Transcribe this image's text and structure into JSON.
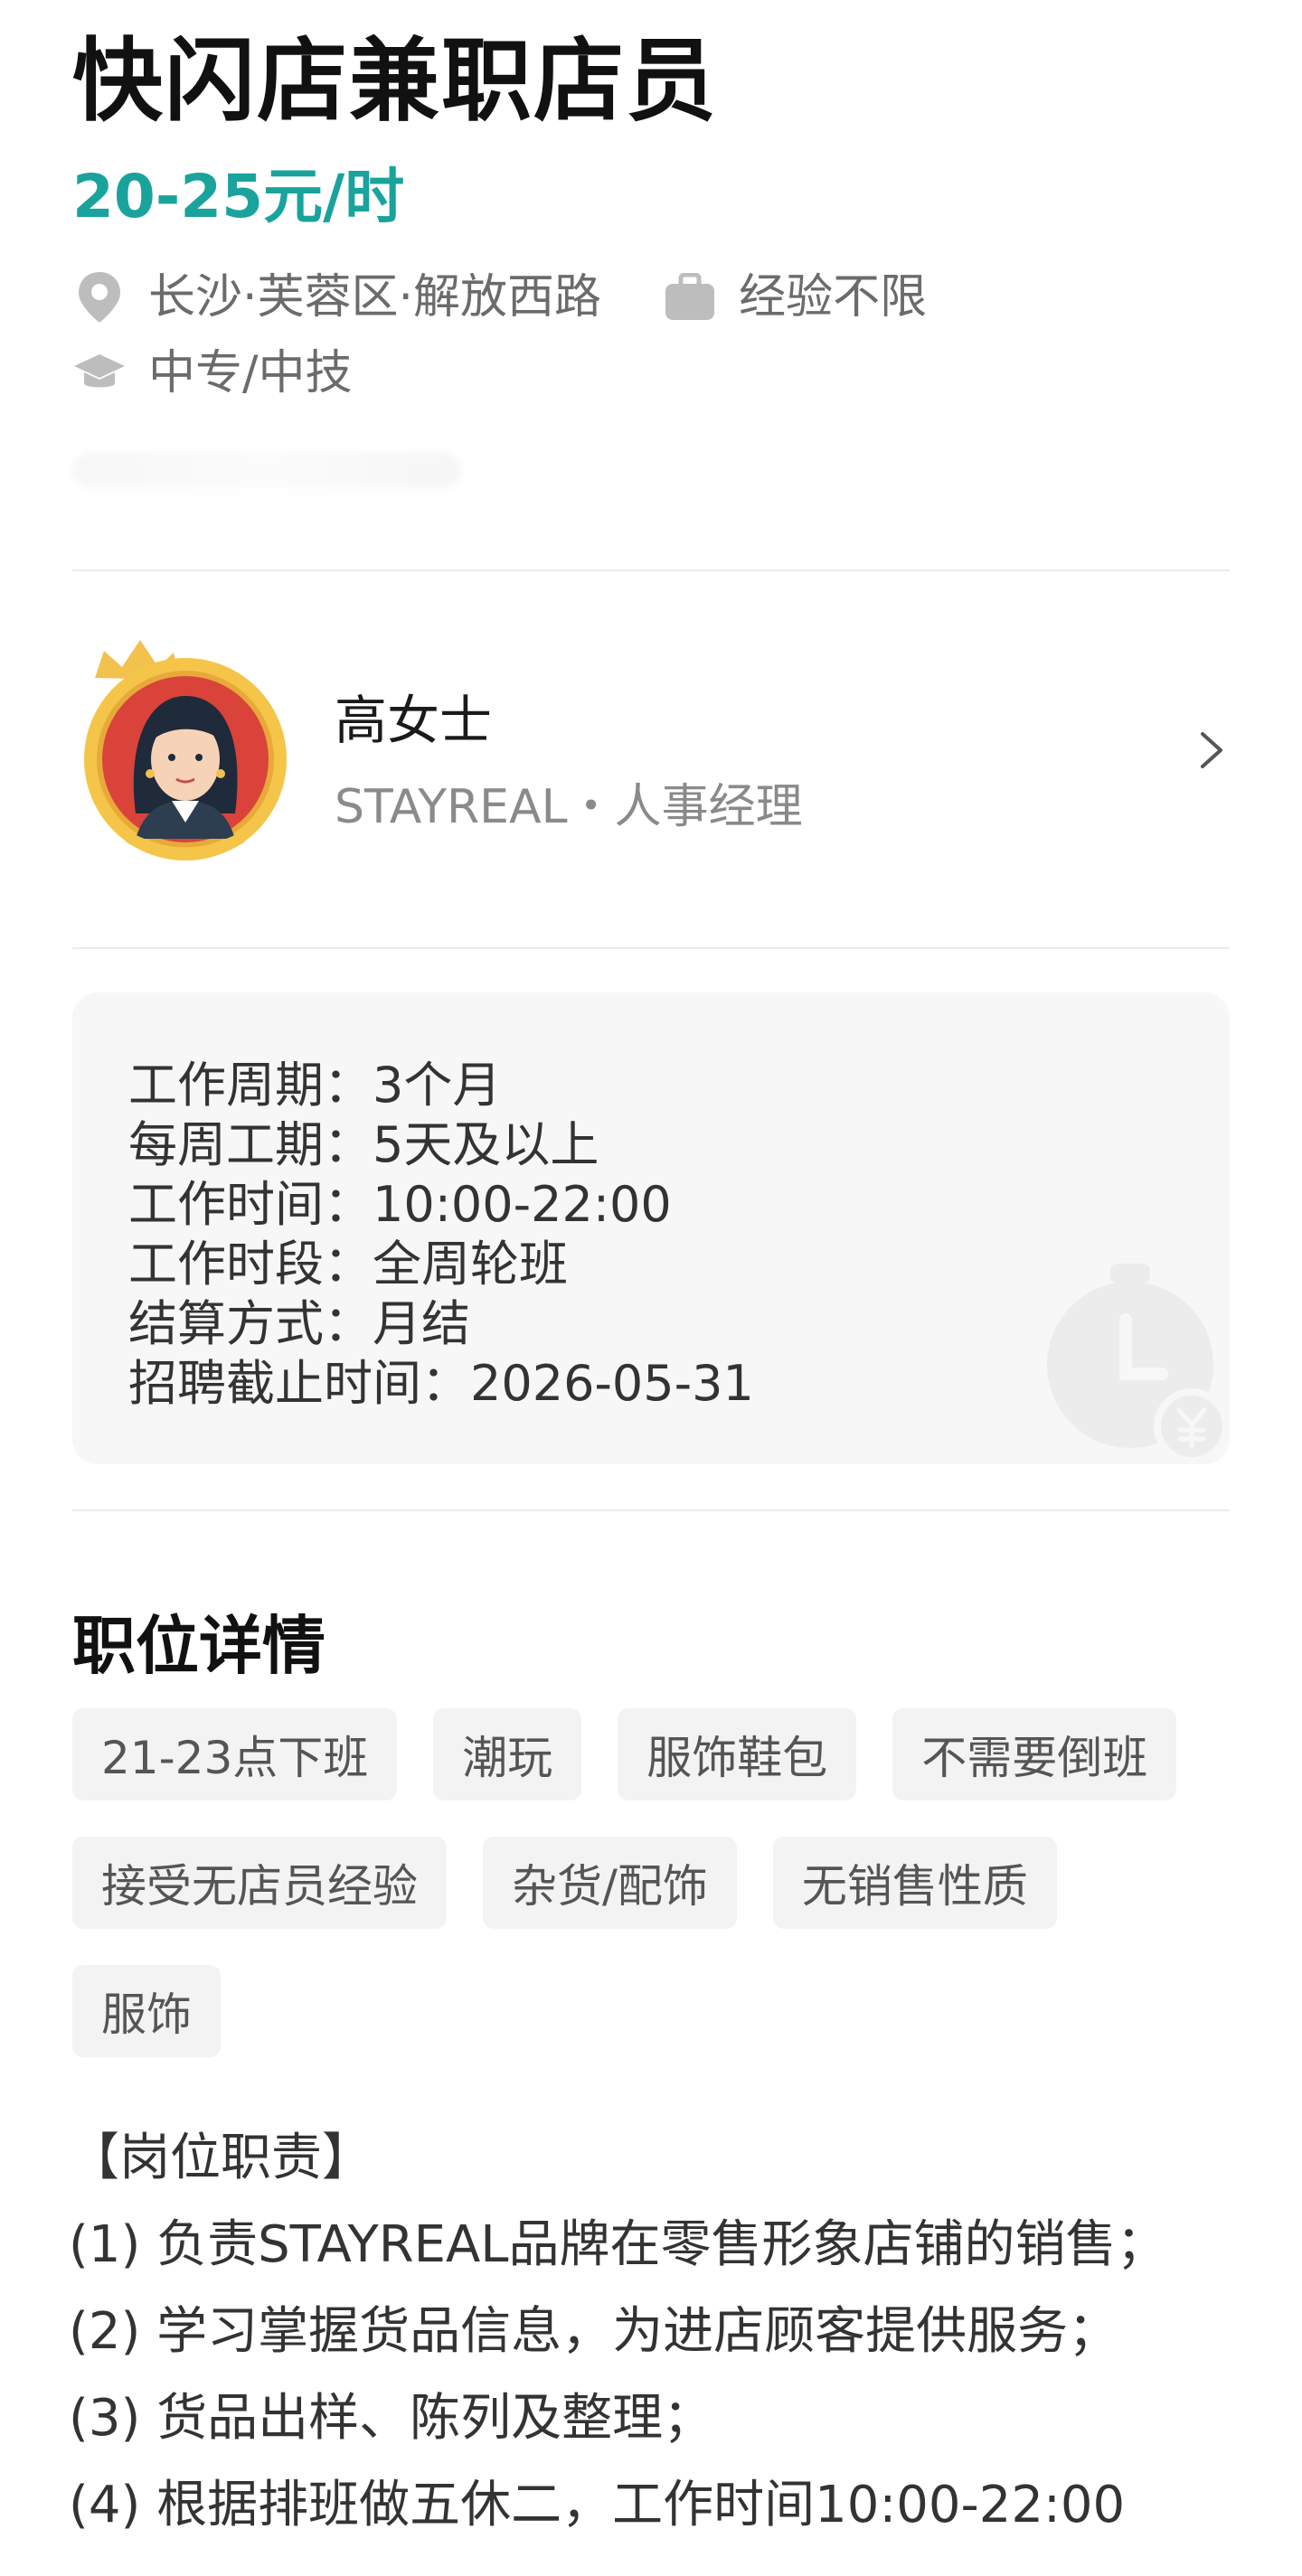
{
  "job": {
    "title": "快闪店兼职店员",
    "salary": "20-25元/时",
    "location": "长沙·芙蓉区·解放西路",
    "experience": "经验不限",
    "education": "中专/中技"
  },
  "recruiter": {
    "name": "高女士",
    "subtitle": "STAYREAL・人事经理"
  },
  "info": [
    "工作周期：3个月",
    "每周工期：5天及以上",
    "工作时间：10:00-22:00",
    "工作时段：全周轮班",
    "结算方式：月结",
    "招聘截止时间：2026-05-31"
  ],
  "details": {
    "section_title": "职位详情",
    "tags": [
      "21-23点下班",
      "潮玩",
      "服饰鞋包",
      "不需要倒班",
      "接受无店员经验",
      "杂货/配饰",
      "无销售性质",
      "服饰"
    ],
    "description": [
      "【岗位职责】",
      "(1) 负责STAYREAL品牌在零售形象店铺的销售；",
      "(2) 学习掌握货品信息，为进店顾客提供服务；",
      "(3) 货品出样、陈列及整理；",
      "(4) 根据排班做五休二，工作时间10:00-22:00"
    ]
  },
  "colors": {
    "accent": "#1aa39c",
    "muted": "#6b6b6b",
    "card": "#f7f7f7",
    "tag": "#f3f3f3"
  },
  "icons": {
    "location": "location-pin-icon",
    "experience": "briefcase-icon",
    "education": "graduation-cap-icon",
    "chevron": "chevron-right-icon",
    "clock": "clock-yen-icon"
  }
}
